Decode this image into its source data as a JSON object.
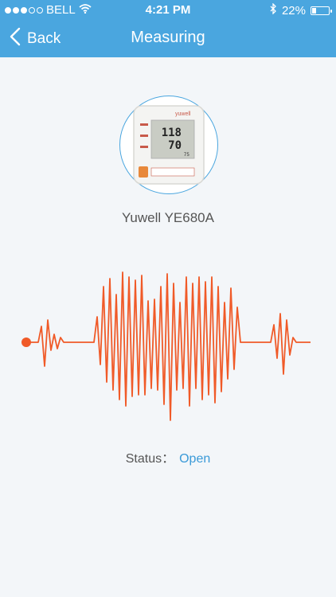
{
  "status_bar": {
    "carrier": "BELL",
    "time": "4:21 PM",
    "battery": "22%",
    "signal_icon": "signal-dots-icon",
    "wifi_icon": "wifi-icon",
    "bluetooth_icon": "bluetooth-icon",
    "battery_icon": "battery-icon"
  },
  "nav": {
    "back_label": "Back",
    "title": "Measuring"
  },
  "device": {
    "name": "Yuwell YE680A",
    "brand_text": "yuwell",
    "display_top": "118",
    "display_bottom": "70",
    "pulse": "75"
  },
  "status": {
    "label": "Status：",
    "value": "Open"
  },
  "colors": {
    "header": "#4aa6df",
    "wave": "#f05a28",
    "status_value": "#3a9ad8"
  }
}
